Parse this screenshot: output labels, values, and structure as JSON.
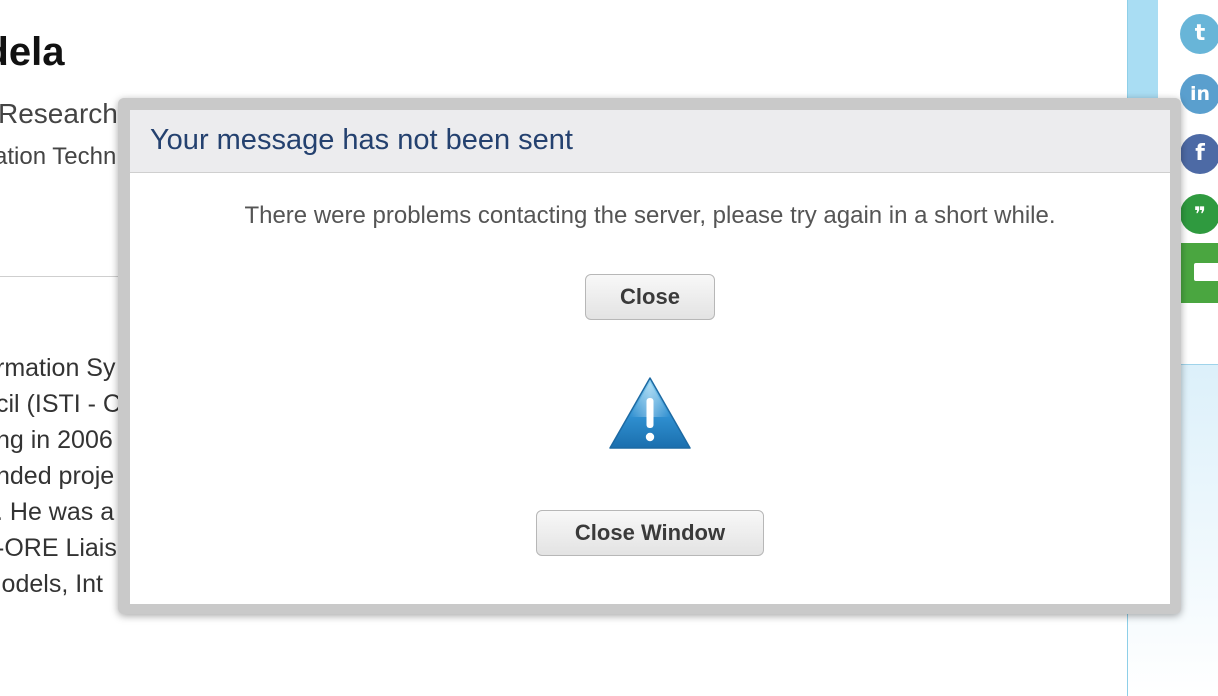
{
  "background": {
    "heading": "ndela",
    "subtitle": "Research",
    "subtitle2": "ation Techn",
    "paragraph_lines": [
      "rmation Sy",
      "cil (ISTI - C",
      "ng in 2006",
      "nded proje",
      ". He was a",
      "-ORE Liais",
      "lodels, Int"
    ]
  },
  "sidebar": {
    "icons": [
      "twitter-icon",
      "linkedin-icon",
      "facebook-icon",
      "hangouts-icon",
      "email-icon"
    ],
    "glyphs": {
      "twitter": "t",
      "linkedin": "in",
      "facebook": "f",
      "hangouts": "❞"
    }
  },
  "dialog": {
    "title": "Your message has not been sent",
    "message": "There were problems contacting the server, please try again in a short while.",
    "close_label": "Close",
    "close_window_label": "Close Window",
    "icon": "warning-icon"
  },
  "colors": {
    "title": "#24416f",
    "header_bg": "#ececee",
    "accent_blue": "#2f8fd0"
  }
}
